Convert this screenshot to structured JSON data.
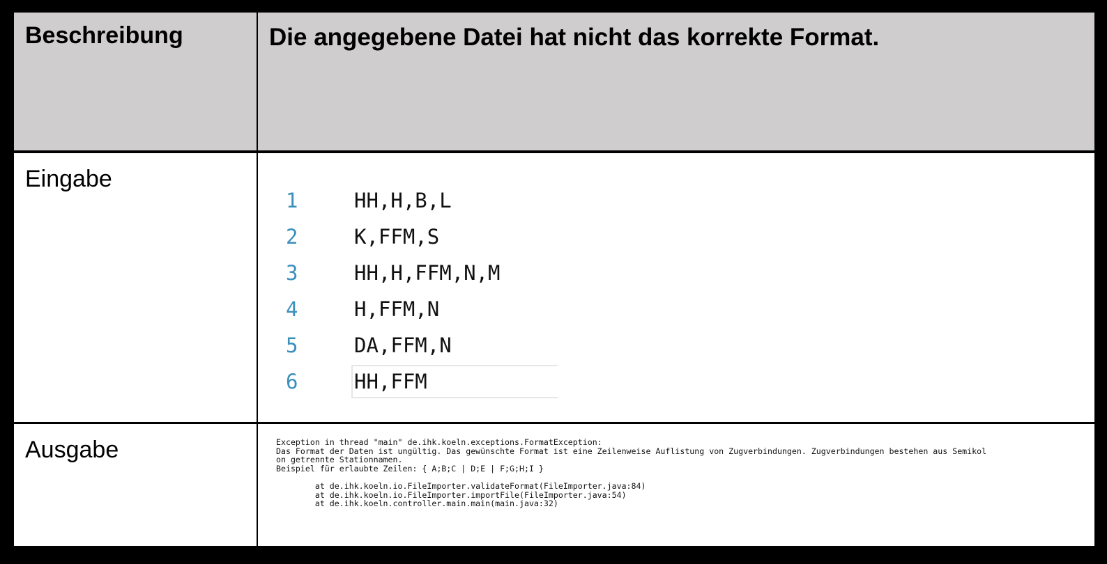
{
  "table": {
    "rows": [
      {
        "label": "Beschreibung",
        "content": "Die angegebene Datei hat nicht das korrekte Format."
      },
      {
        "label": "Eingabe",
        "code_lines": [
          {
            "number": "1",
            "text": "HH,H,B,L"
          },
          {
            "number": "2",
            "text": "K,FFM,S"
          },
          {
            "number": "3",
            "text": "HH,H,FFM,N,M"
          },
          {
            "number": "4",
            "text": "H,FFM,N"
          },
          {
            "number": "5",
            "text": "DA,FFM,N"
          },
          {
            "number": "6",
            "text": "HH,FFM"
          }
        ]
      },
      {
        "label": "Ausgabe",
        "console_lines": [
          "Exception in thread \"main\" de.ihk.koeln.exceptions.FormatException:",
          "Das Format der Daten ist ungültig. Das gewünschte Format ist eine Zeilenweise Auflistung von Zugverbindungen. Zugverbindungen bestehen aus Semikol",
          "on getrennte Stationnamen.",
          "Beispiel für erlaubte Zeilen: { A;B;C | D;E | F;G;H;I }",
          "",
          "        at de.ihk.koeln.io.FileImporter.validateFormat(FileImporter.java:84)",
          "        at de.ihk.koeln.io.FileImporter.importFile(FileImporter.java:54)",
          "        at de.ihk.koeln.controller.main.main(main.java:32)"
        ]
      }
    ]
  },
  "colors": {
    "header_background": "#cfcdce",
    "border": "#000000",
    "line_number": "#3b8fbd"
  }
}
